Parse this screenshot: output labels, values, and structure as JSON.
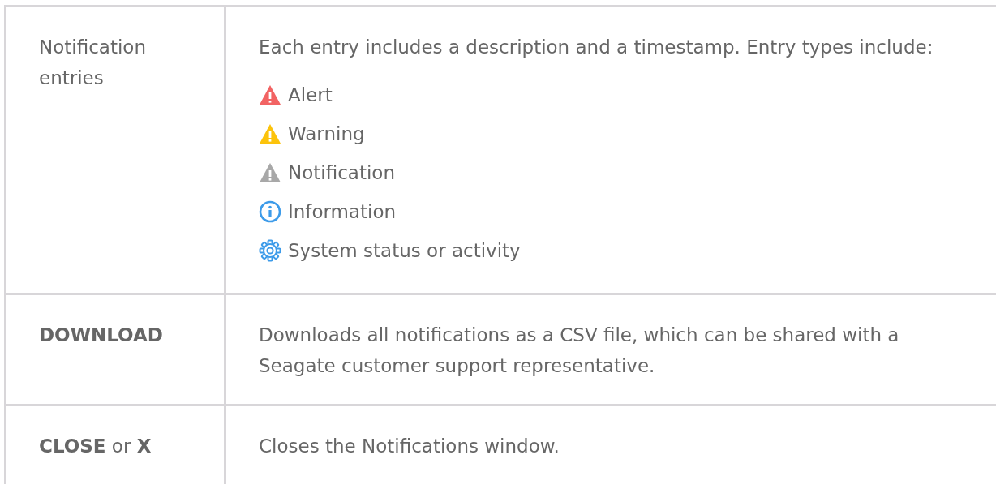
{
  "table": {
    "rows": [
      {
        "term": "Notification entries",
        "bold": false,
        "description": "Each entry includes a description and a timestamp. Entry types include:",
        "entry_types": [
          {
            "kind": "alert",
            "label": "Alert",
            "color": "#f26363"
          },
          {
            "kind": "warning",
            "label": "Warning",
            "color": "#fcc30b"
          },
          {
            "kind": "notification",
            "label": "Notification",
            "color": "#a8a8a8"
          },
          {
            "kind": "information",
            "label": "Information",
            "color": "#3d9be9"
          },
          {
            "kind": "status",
            "label": "System status or activity",
            "color": "#3d9be9"
          }
        ]
      },
      {
        "term": "DOWNLOAD",
        "bold": true,
        "description": "Downloads all notifications as a CSV file, which can be shared with a Seagate customer support representative."
      },
      {
        "term": "**CLOSE** or **X**",
        "bold": false,
        "description": "Closes the Notifications window."
      }
    ]
  }
}
